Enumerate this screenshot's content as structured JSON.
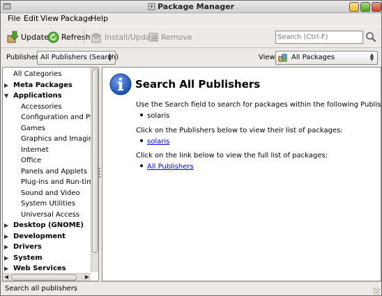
{
  "window": {
    "title": "Package Manager"
  },
  "menubar": {
    "items": [
      {
        "label": "File"
      },
      {
        "label": "Edit"
      },
      {
        "label": "View"
      },
      {
        "label": "Package"
      },
      {
        "label": "Help"
      }
    ]
  },
  "toolbar": {
    "updates_label": "Updates",
    "refresh_label": "Refresh",
    "install_label": "Install/Update",
    "remove_label": "Remove",
    "search_placeholder": "Search (Ctrl-F)"
  },
  "filters": {
    "publisher_label": "Publisher:",
    "publisher_value": "All Publishers (Search)",
    "view_label": "View:",
    "view_value": "All Packages"
  },
  "categories": [
    {
      "label": "All Categories"
    },
    {
      "label": "Meta Packages"
    },
    {
      "label": "Applications"
    },
    {
      "label": "Accessories"
    },
    {
      "label": "Configuration and Preferences"
    },
    {
      "label": "Games"
    },
    {
      "label": "Graphics and Imaging"
    },
    {
      "label": "Internet"
    },
    {
      "label": "Office"
    },
    {
      "label": "Panels and Applets"
    },
    {
      "label": "Plug-ins and Run-times"
    },
    {
      "label": "Sound and Video"
    },
    {
      "label": "System Utilities"
    },
    {
      "label": "Universal Access"
    },
    {
      "label": "Desktop (GNOME)"
    },
    {
      "label": "Development"
    },
    {
      "label": "Drivers"
    },
    {
      "label": "System"
    },
    {
      "label": "Web Services"
    }
  ],
  "main": {
    "heading": "Search All Publishers",
    "intro": "Use the Search field to search for packages within the following Publishers:",
    "publisher_name": "solaris",
    "click_publishers": "Click on the Publishers below to view their list of packages:",
    "publisher_link": "solaris",
    "click_link": "Click on the link below to view the full list of packages:",
    "all_publishers_link": "All Publishers"
  },
  "statusbar": {
    "text": "Search all publishers"
  },
  "colors": {
    "link": "#0000ee",
    "info_icon": "#1a4fb0"
  }
}
